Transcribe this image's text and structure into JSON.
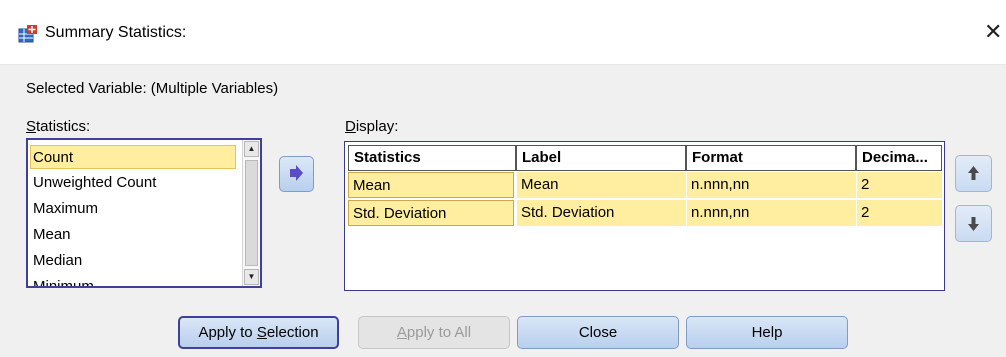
{
  "window": {
    "title": "Summary Statistics:",
    "close_glyph": "✕"
  },
  "selected_variable": "Selected Variable: (Multiple Variables)",
  "statistics": {
    "label_underlined": "S",
    "label_rest": "tatistics:",
    "items": [
      "Count",
      "Unweighted Count",
      "Maximum",
      "Mean",
      "Median",
      "Minimum"
    ],
    "selected_index": 0
  },
  "display": {
    "label_underlined": "D",
    "label_rest": "isplay:",
    "columns": [
      "Statistics",
      "Label",
      "Format",
      "Decima..."
    ],
    "rows": [
      [
        "Mean",
        "Mean",
        "n.nnn,nn",
        "2"
      ],
      [
        "Std. Deviation",
        "Std. Deviation",
        "n.nnn,nn",
        "2"
      ]
    ]
  },
  "buttons": {
    "apply_selection_pre": "Apply to ",
    "apply_selection_u": "S",
    "apply_selection_post": "election",
    "apply_all_u": "A",
    "apply_all_rest": "pply to All",
    "close": "Close",
    "help": "Help"
  },
  "icons": {
    "app": "spss-table-icon",
    "move": "arrow-right-icon",
    "up": "arrow-up-icon",
    "down": "arrow-down-icon"
  },
  "colors": {
    "selection_fill": "#ffeda0",
    "button_blue": "#b9cfee",
    "focus_border": "#3f3f9c"
  }
}
